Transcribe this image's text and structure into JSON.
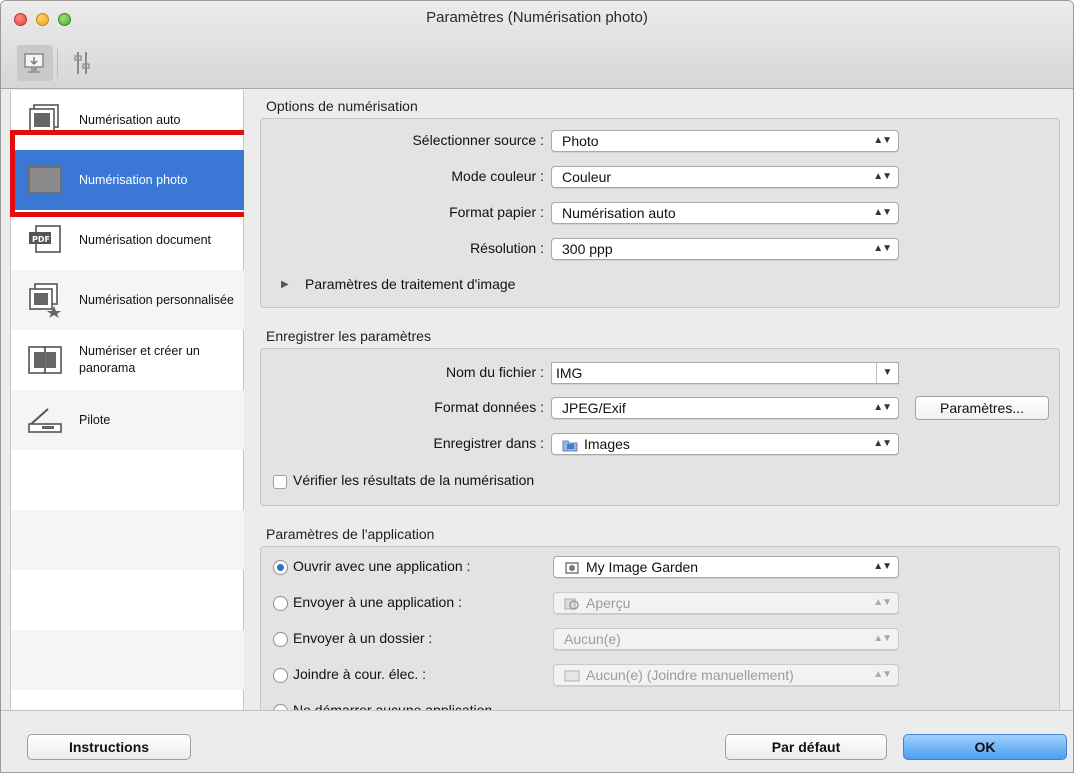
{
  "window": {
    "title": "Paramètres (Numérisation photo)"
  },
  "toolbar": {
    "scan_icon": "scan-from-computer-icon",
    "settings_icon": "general-settings-icon"
  },
  "sidebar": {
    "items": [
      {
        "label": "Numérisation auto",
        "icon": "auto-scan-icon"
      },
      {
        "label": "Numérisation photo",
        "icon": "photo-scan-icon",
        "selected": true
      },
      {
        "label": "Numérisation document",
        "icon": "pdf-document-icon"
      },
      {
        "label": "Numérisation personnalisée",
        "icon": "custom-scan-icon"
      },
      {
        "label": "Numériser et créer un panorama",
        "icon": "panorama-icon"
      },
      {
        "label": "Pilote",
        "icon": "driver-icon"
      }
    ]
  },
  "scan_options": {
    "title": "Options de numérisation",
    "source_label": "Sélectionner source :",
    "source_value": "Photo",
    "color_label": "Mode couleur :",
    "color_value": "Couleur",
    "paper_label": "Format papier :",
    "paper_value": "Numérisation auto",
    "resolution_label": "Résolution :",
    "resolution_value": "300 ppp",
    "image_processing_label": "Paramètres de traitement d'image"
  },
  "save_settings": {
    "title": "Enregistrer les paramètres",
    "filename_label": "Nom du fichier :",
    "filename_value": "IMG",
    "format_label": "Format données :",
    "format_value": "JPEG/Exif",
    "format_button": "Paramètres...",
    "save_in_label": "Enregistrer dans :",
    "save_in_value": "Images",
    "verify_label": "Vérifier les résultats de la numérisation"
  },
  "app_settings": {
    "title": "Paramètres de l'application",
    "options": [
      {
        "label": "Ouvrir avec une application :",
        "value": "My Image Garden",
        "selected": true,
        "enabled": true
      },
      {
        "label": "Envoyer à une application :",
        "value": "Aperçu",
        "selected": false,
        "enabled": false
      },
      {
        "label": "Envoyer à un dossier :",
        "value": "Aucun(e)",
        "selected": false,
        "enabled": false
      },
      {
        "label": "Joindre à cour. élec. :",
        "value": "Aucun(e) (Joindre manuellement)",
        "selected": false,
        "enabled": false
      },
      {
        "label": "Ne démarrer aucune application",
        "selected": false
      }
    ]
  },
  "footer": {
    "instructions": "Instructions",
    "default": "Par défaut",
    "ok": "OK"
  }
}
